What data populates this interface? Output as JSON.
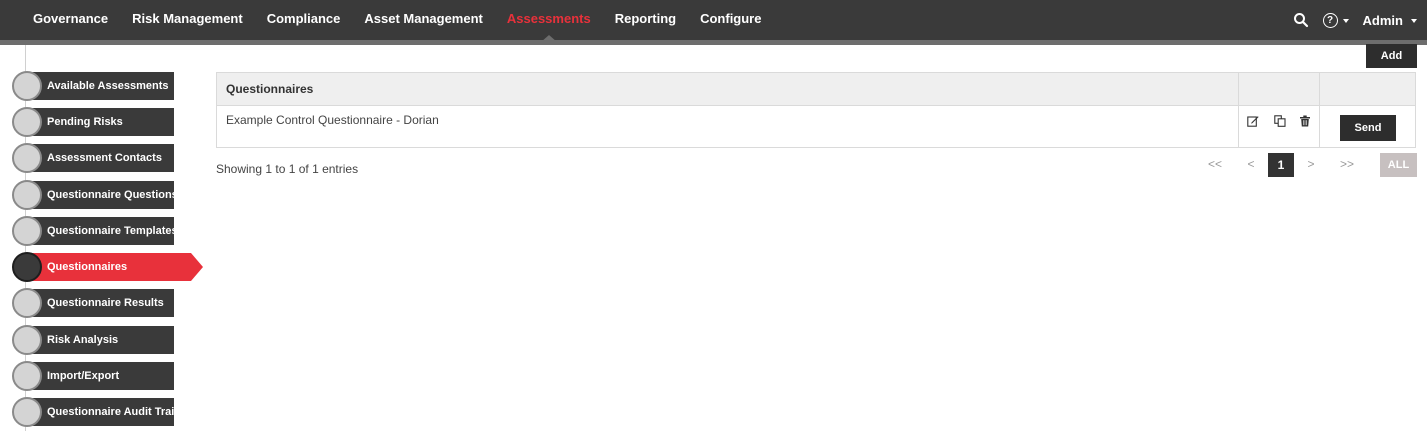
{
  "nav": {
    "items": [
      {
        "label": "Governance"
      },
      {
        "label": "Risk Management"
      },
      {
        "label": "Compliance"
      },
      {
        "label": "Asset Management"
      },
      {
        "label": "Assessments"
      },
      {
        "label": "Reporting"
      },
      {
        "label": "Configure"
      }
    ],
    "active_index": 4,
    "user_label": "Admin",
    "help_glyph": "?",
    "accent_color": "#e8313b"
  },
  "sidebar": {
    "items": [
      {
        "label": "Available Assessments"
      },
      {
        "label": "Pending Risks"
      },
      {
        "label": "Assessment Contacts"
      },
      {
        "label": "Questionnaire Questions"
      },
      {
        "label": "Questionnaire Templates"
      },
      {
        "label": "Questionnaires"
      },
      {
        "label": "Questionnaire Results"
      },
      {
        "label": "Risk Analysis"
      },
      {
        "label": "Import/Export"
      },
      {
        "label": "Questionnaire Audit Trail"
      }
    ],
    "active_index": 5
  },
  "main": {
    "add_label": "Add",
    "table": {
      "header": "Questionnaires",
      "rows": [
        {
          "name": "Example Control Questionnaire - Dorian",
          "send_label": "Send",
          "actions": [
            "edit-icon",
            "copy-icon",
            "trash-icon"
          ]
        }
      ]
    },
    "showing_text": "Showing 1 to 1 of 1 entries",
    "pagination": {
      "first": "<<",
      "prev": "<",
      "current": "1",
      "next": ">",
      "last": ">>",
      "all": "ALL"
    }
  }
}
